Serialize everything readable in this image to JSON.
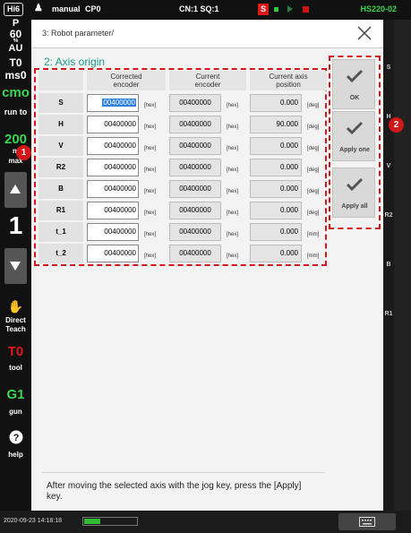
{
  "topbar": {
    "badge": "Hi6",
    "mode": "manual",
    "program": "CP0",
    "cn_sq": "CN:1 SQ:1",
    "status_s": "S",
    "model": "HS220-02"
  },
  "leftbar": {
    "p_label": "P",
    "speed_label": "60",
    "unit1": "%",
    "au": "AU",
    "t0_label": "T0",
    "ms0": "ms0",
    "cmd": "cmo",
    "run_to": "run to",
    "speed200": "200",
    "m": "m",
    "max": "max",
    "step_value": "1",
    "direct_teach": "Direct\nTeach",
    "tool_value": "T0",
    "tool_label": "tool",
    "gun_value": "G1",
    "gun_label": "gun",
    "help_label": "help"
  },
  "rightbar": {
    "labels": [
      "S",
      "H",
      "V",
      "R2",
      "B",
      "R1"
    ]
  },
  "dialog": {
    "path": "3: Robot parameter/",
    "section_title": "2: Axis origin",
    "footer_message": "After moving the selected axis with the jog key, press the [Apply] key."
  },
  "table": {
    "headers": {
      "corrected": "Corrected\nencoder",
      "current": "Current\nencoder",
      "position": "Current axis\nposition"
    },
    "rows": [
      {
        "axis": "S",
        "corrected": "00400000",
        "current": "00400000",
        "position": "0.000",
        "unit": "[deg]"
      },
      {
        "axis": "H",
        "corrected": "00400000",
        "current": "00400000",
        "position": "90.000",
        "unit": "[deg]"
      },
      {
        "axis": "V",
        "corrected": "00400000",
        "current": "00400000",
        "position": "0.000",
        "unit": "[deg]"
      },
      {
        "axis": "R2",
        "corrected": "00400000",
        "current": "00400000",
        "position": "0.000",
        "unit": "[deg]"
      },
      {
        "axis": "B",
        "corrected": "00400000",
        "current": "00400000",
        "position": "0.000",
        "unit": "[deg]"
      },
      {
        "axis": "R1",
        "corrected": "00400000",
        "current": "00400000",
        "position": "0.000",
        "unit": "[deg]"
      },
      {
        "axis": "t_1",
        "corrected": "00400000",
        "current": "00400000",
        "position": "0.000",
        "unit": "[mm]"
      },
      {
        "axis": "t_2",
        "corrected": "00400000",
        "current": "00400000",
        "position": "0.000",
        "unit": "[mm]"
      }
    ],
    "hex_unit": "[hex]"
  },
  "buttons": {
    "ok": "OK",
    "apply_one": "Apply one",
    "apply_all": "Apply all"
  },
  "markers": {
    "one": "1",
    "two": "2"
  },
  "bottombar": {
    "datetime": "2020-09-23 14:18:18"
  },
  "colors": {
    "accent": "#1a9a8a",
    "highlight": "#d01818",
    "selection": "#2f7fe0",
    "model_text": "#3dd64f"
  }
}
